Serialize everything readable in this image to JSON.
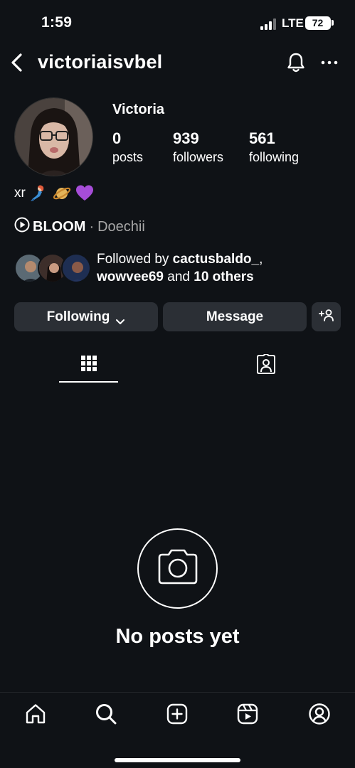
{
  "status_bar": {
    "time": "1:59",
    "network": "LTE",
    "battery": "72"
  },
  "header": {
    "username": "victoriaisvbel",
    "back_icon": "chevron-left-icon",
    "notifications_icon": "bell-icon",
    "more_icon": "more-horizontal-icon"
  },
  "profile": {
    "display_name": "Victoria",
    "stats": [
      {
        "value": "0",
        "label": "posts"
      },
      {
        "value": "939",
        "label": "followers"
      },
      {
        "value": "561",
        "label": "following"
      }
    ],
    "bio_text": "xr",
    "bio_emojis": [
      "mermaid-emoji",
      "ringed-planet-emoji",
      "purple-heart-emoji"
    ],
    "music": {
      "title": "BLOOM",
      "separator": "·",
      "artist": "Doechii"
    },
    "followed_by": {
      "prefix": "Followed by ",
      "user1": "cactusbaldo_",
      "comma": ",",
      "user2": "wowvee69",
      "and_text": " and ",
      "others": "10 others"
    }
  },
  "actions": {
    "following_label": "Following",
    "message_label": "Message",
    "add_person_icon": "add-person-icon"
  },
  "tabs": [
    {
      "name": "grid",
      "icon": "grid-icon",
      "active": true
    },
    {
      "name": "tagged",
      "icon": "tagged-person-icon",
      "active": false
    }
  ],
  "empty_state": {
    "icon": "camera-icon",
    "text": "No posts yet"
  },
  "bottom_nav": [
    {
      "name": "home",
      "icon": "home-icon"
    },
    {
      "name": "search",
      "icon": "search-icon"
    },
    {
      "name": "create",
      "icon": "plus-square-icon"
    },
    {
      "name": "reels",
      "icon": "reels-icon"
    },
    {
      "name": "profile",
      "icon": "profile-icon"
    }
  ],
  "colors": {
    "background": "#0f1216",
    "button_bg": "#2b2f35",
    "muted_text": "#a8a8a8"
  }
}
